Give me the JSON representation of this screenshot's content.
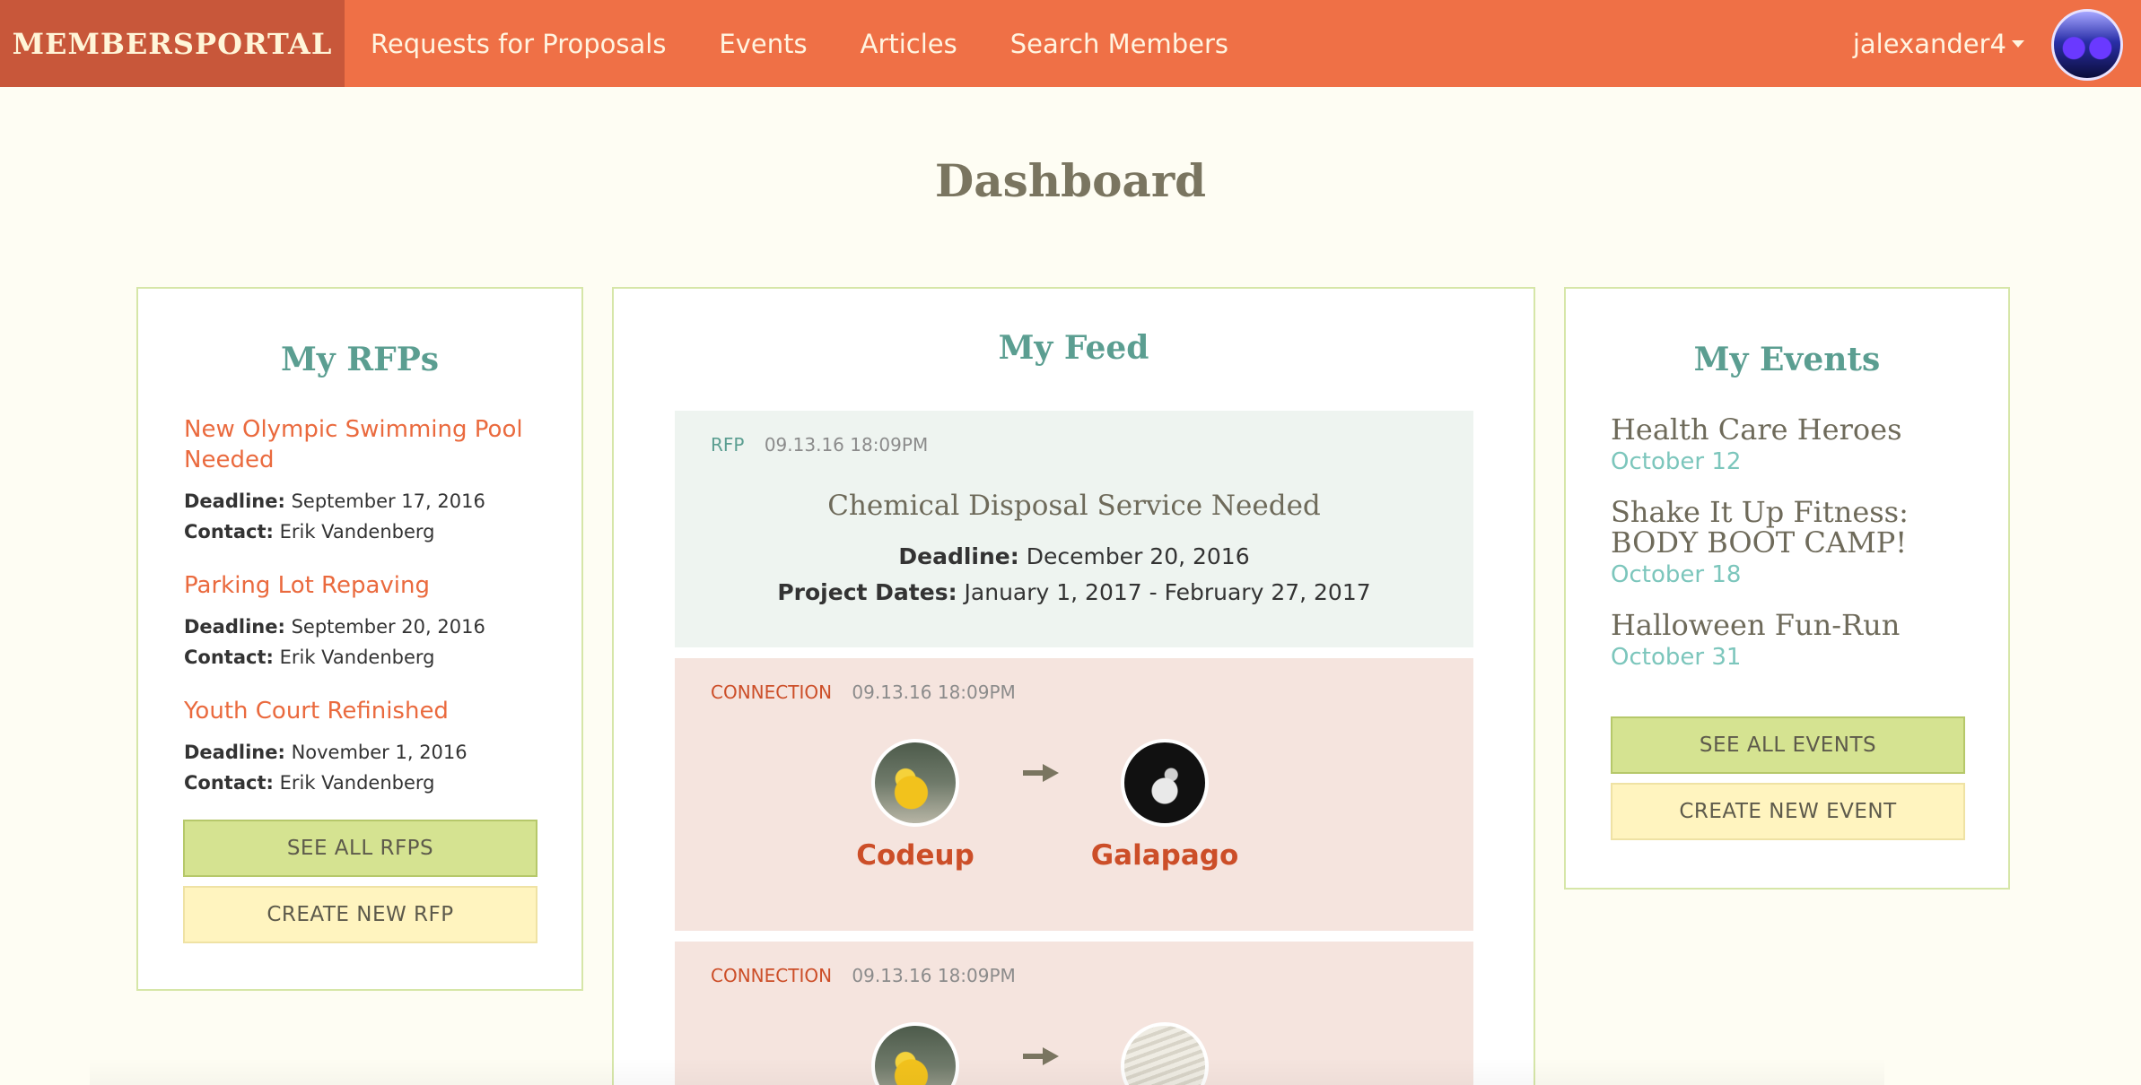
{
  "nav": {
    "brand": "MEMBERSPORTAL",
    "links": [
      "Requests for Proposals",
      "Events",
      "Articles",
      "Search Members"
    ],
    "user": "jalexander4",
    "avatar_icon": "user-avatar",
    "accent_color": "#ef7046",
    "brand_bg": "#c8573a"
  },
  "page": {
    "title": "Dashboard"
  },
  "rfps": {
    "title": "My RFPs",
    "deadline_label": "Deadline:",
    "contact_label": "Contact:",
    "items": [
      {
        "title": "New Olympic Swimming Pool Needed",
        "deadline": "September 17, 2016",
        "contact": "Erik Vandenberg"
      },
      {
        "title": "Parking Lot Repaving",
        "deadline": "September 20, 2016",
        "contact": "Erik Vandenberg"
      },
      {
        "title": "Youth Court Refinished",
        "deadline": "November 1, 2016",
        "contact": "Erik Vandenberg"
      }
    ],
    "see_all_label": "SEE ALL RFPS",
    "create_label": "CREATE NEW RFP"
  },
  "feed": {
    "title": "My Feed",
    "cards": [
      {
        "type": "RFP",
        "timestamp": "09.13.16 18:09PM",
        "title": "Chemical Disposal Service Needed",
        "deadline_label": "Deadline:",
        "deadline": "December 20, 2016",
        "dates_label": "Project Dates:",
        "dates": "January 1, 2017 - February 27, 2017"
      },
      {
        "type": "CONNECTION",
        "timestamp": "09.13.16 18:09PM",
        "from": "Codeup",
        "to": "Galapago"
      },
      {
        "type": "CONNECTION",
        "timestamp": "09.13.16 18:09PM"
      }
    ]
  },
  "events": {
    "title": "My Events",
    "items": [
      {
        "name": "Health Care Heroes",
        "date": "October 12"
      },
      {
        "name": "Shake It Up Fitness: BODY BOOT CAMP!",
        "date": "October 18"
      },
      {
        "name": "Halloween Fun-Run",
        "date": "October 31"
      }
    ],
    "see_all_label": "SEE ALL EVENTS",
    "create_label": "CREATE NEW EVENT"
  }
}
